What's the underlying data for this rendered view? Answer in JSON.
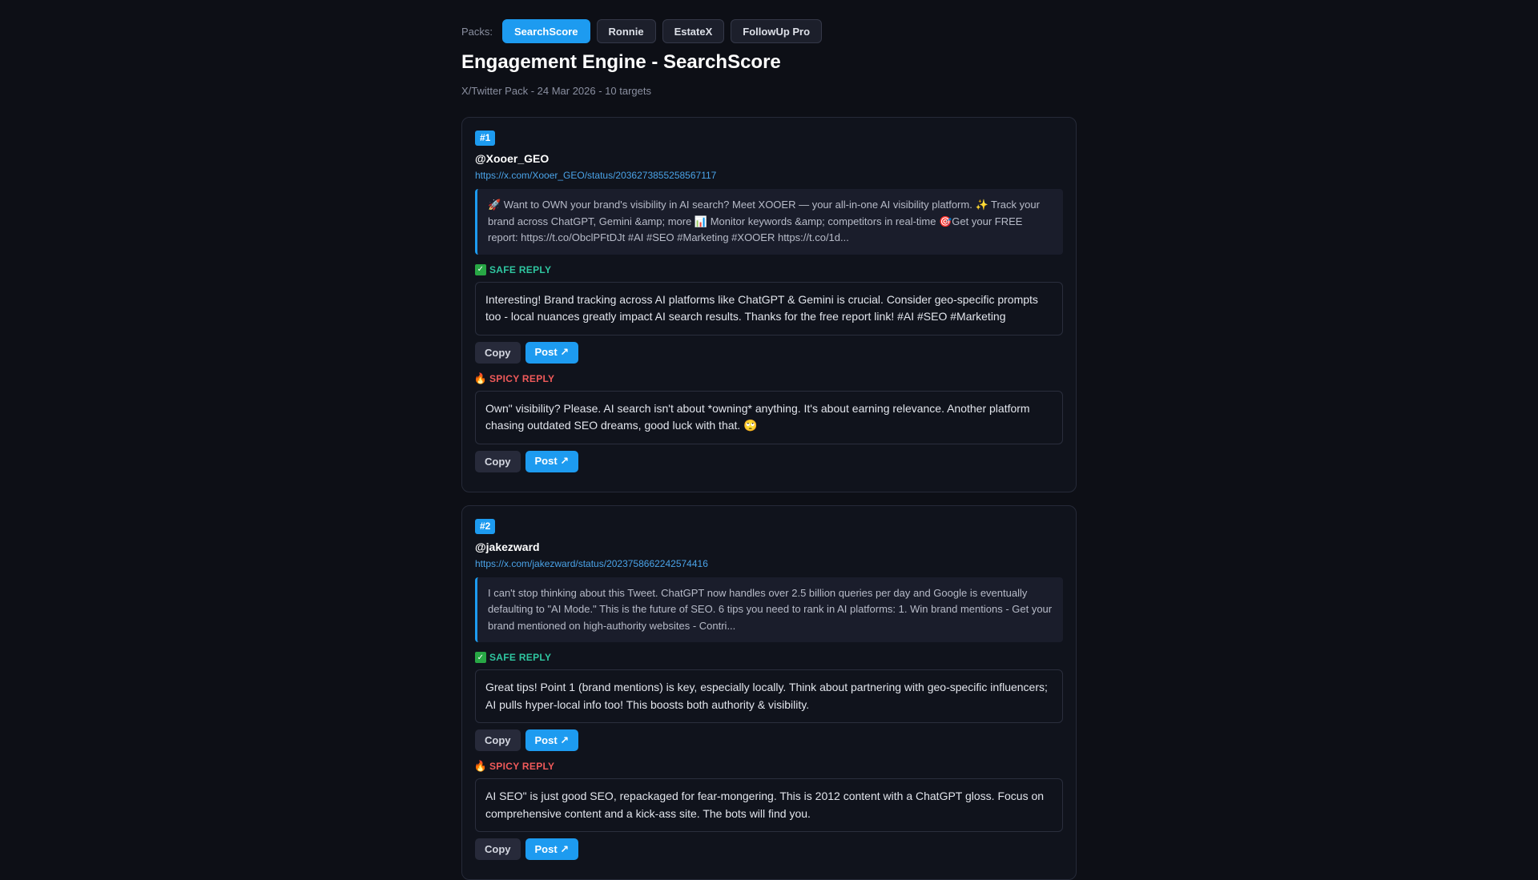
{
  "packs": {
    "label": "Packs:",
    "items": [
      {
        "label": "SearchScore",
        "active": true
      },
      {
        "label": "Ronnie",
        "active": false
      },
      {
        "label": "EstateX",
        "active": false
      },
      {
        "label": "FollowUp Pro",
        "active": false
      }
    ]
  },
  "header": {
    "title": "Engagement Engine - SearchScore",
    "subtitle": "X/Twitter Pack - 24 Mar 2026 - 10 targets"
  },
  "labels": {
    "safe": "SAFE REPLY",
    "spicy": "SPICY REPLY",
    "copy": "Copy",
    "post": "Post ↗"
  },
  "colors": {
    "accent": "#1d9bf0",
    "safe": "#2fc6a0",
    "spicy": "#f05a5a",
    "background": "#0d0f16"
  },
  "targets": [
    {
      "rank": "#1",
      "handle": "@Xooer_GEO",
      "url": "https://x.com/Xooer_GEO/status/2036273855258567117",
      "tweet": "🚀 Want to OWN your brand's visibility in AI search? Meet XOOER — your all-in-one AI visibility platform. ✨ Track your brand across ChatGPT, Gemini &amp; more 📊 Monitor keywords &amp; competitors in real-time 🎯Get your FREE report: https://t.co/ObclPFtDJt #AI #SEO #Marketing #XOOER https://t.co/1d...",
      "safe_reply": "Interesting! Brand tracking across AI platforms like ChatGPT & Gemini is crucial. Consider geo-specific prompts too - local nuances greatly impact AI search results. Thanks for the free report link! #AI #SEO #Marketing",
      "spicy_reply": "Own\" visibility? Please. AI search isn't about *owning* anything. It's about earning relevance. Another platform chasing outdated SEO dreams, good luck with that. 🙄"
    },
    {
      "rank": "#2",
      "handle": "@jakezward",
      "url": "https://x.com/jakezward/status/2023758662242574416",
      "tweet": "I can't stop thinking about this Tweet. ChatGPT now handles over 2.5 billion queries per day and Google is eventually defaulting to \"AI Mode.\" This is the future of SEO. 6 tips you need to rank in AI platforms: 1. Win brand mentions - Get your brand mentioned on high-authority websites - Contri...",
      "safe_reply": "Great tips! Point 1 (brand mentions) is key, especially locally. Think about partnering with geo-specific influencers; AI pulls hyper-local info too! This boosts both authority & visibility.",
      "spicy_reply": "AI SEO\" is just good SEO, repackaged for fear-mongering. This is 2012 content with a ChatGPT gloss. Focus on comprehensive content and a kick-ass site. The bots will find you."
    }
  ]
}
